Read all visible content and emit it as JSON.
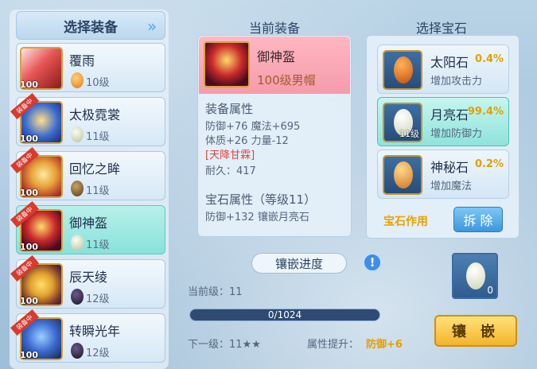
{
  "left": {
    "title": "选择装备",
    "items": [
      {
        "name": "覆雨",
        "gem_level": "10级",
        "level": "100",
        "tag": "",
        "gem": "sun"
      },
      {
        "name": "太极霓裳",
        "gem_level": "11级",
        "level": "100",
        "tag": "装备中",
        "gem": "moon"
      },
      {
        "name": "回忆之眸",
        "gem_level": "11级",
        "level": "100",
        "tag": "装备中",
        "gem": "dark"
      },
      {
        "name": "御神盔",
        "gem_level": "11级",
        "level": "100",
        "tag": "装备中",
        "gem": "moon"
      },
      {
        "name": "辰天绫",
        "gem_level": "12级",
        "level": "100",
        "tag": "装备中",
        "gem": "black"
      },
      {
        "name": "转瞬光年",
        "gem_level": "12级",
        "level": "100",
        "tag": "装备中",
        "gem": "black"
      }
    ]
  },
  "middle": {
    "title": "当前装备",
    "item_name": "御神盔",
    "item_sub": "100级男帽",
    "attr_title": "装备属性",
    "attr_line1": "防御+76 魔法+695",
    "attr_line2": "体质+26 力量-12",
    "special": "[天降甘霖]",
    "durability": "耐久：417",
    "gem_attr_title": "宝石属性（等级11）",
    "gem_attr_line": "防御+132 镶嵌月亮石",
    "progress_title": "镶嵌进度",
    "current_level": "当前级：11",
    "progress_text": "0/1024",
    "progress_fraction": 0.0,
    "next_level": "下一级：11★★",
    "boost_label": "属性提升：",
    "boost_value": "防御+6"
  },
  "right": {
    "title": "选择宝石",
    "gems": [
      {
        "name": "太阳石",
        "pct": "0.4%",
        "desc": "增加攻击力",
        "count": ""
      },
      {
        "name": "月亮石",
        "pct": "99.4%",
        "desc": "增加防御力",
        "count": "11级"
      },
      {
        "name": "神秘石",
        "pct": "0.2%",
        "desc": "增加魔法",
        "count": ""
      }
    ],
    "gem_effect": "宝石作用",
    "remove_button": "拆 除",
    "slot_count": "0",
    "inlay_button": "镶 嵌"
  },
  "colors": {
    "accent": "#4ea7e6",
    "gold": "#e2a000",
    "selected": "#8fe3db"
  }
}
